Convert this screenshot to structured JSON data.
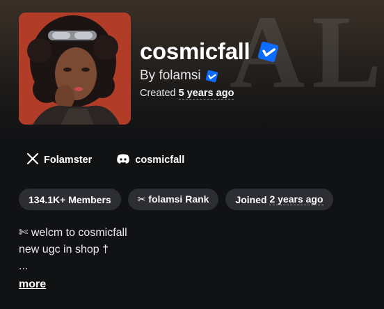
{
  "group": {
    "name": "cosmicfall",
    "owner_label": "By folamsi",
    "created_prefix": "Created",
    "created_value": "5 years ago"
  },
  "socials": [
    {
      "icon": "x-icon",
      "label": "Folamster"
    },
    {
      "icon": "discord-icon",
      "label": "cosmicfall"
    }
  ],
  "stats": {
    "members": "134.1K+ Members",
    "rank": "✂ folamsi Rank",
    "joined_prefix": "Joined",
    "joined_value": "2 years ago"
  },
  "description": {
    "line1": "✄ welcm to cosmicfall",
    "line2": "new ugc in shop †",
    "line3": "..."
  },
  "more_label": "more",
  "colors": {
    "background": "#111214",
    "pill": "#2d2e33",
    "verified": "#0b6cff",
    "avatar_bg": "#b5402b"
  }
}
